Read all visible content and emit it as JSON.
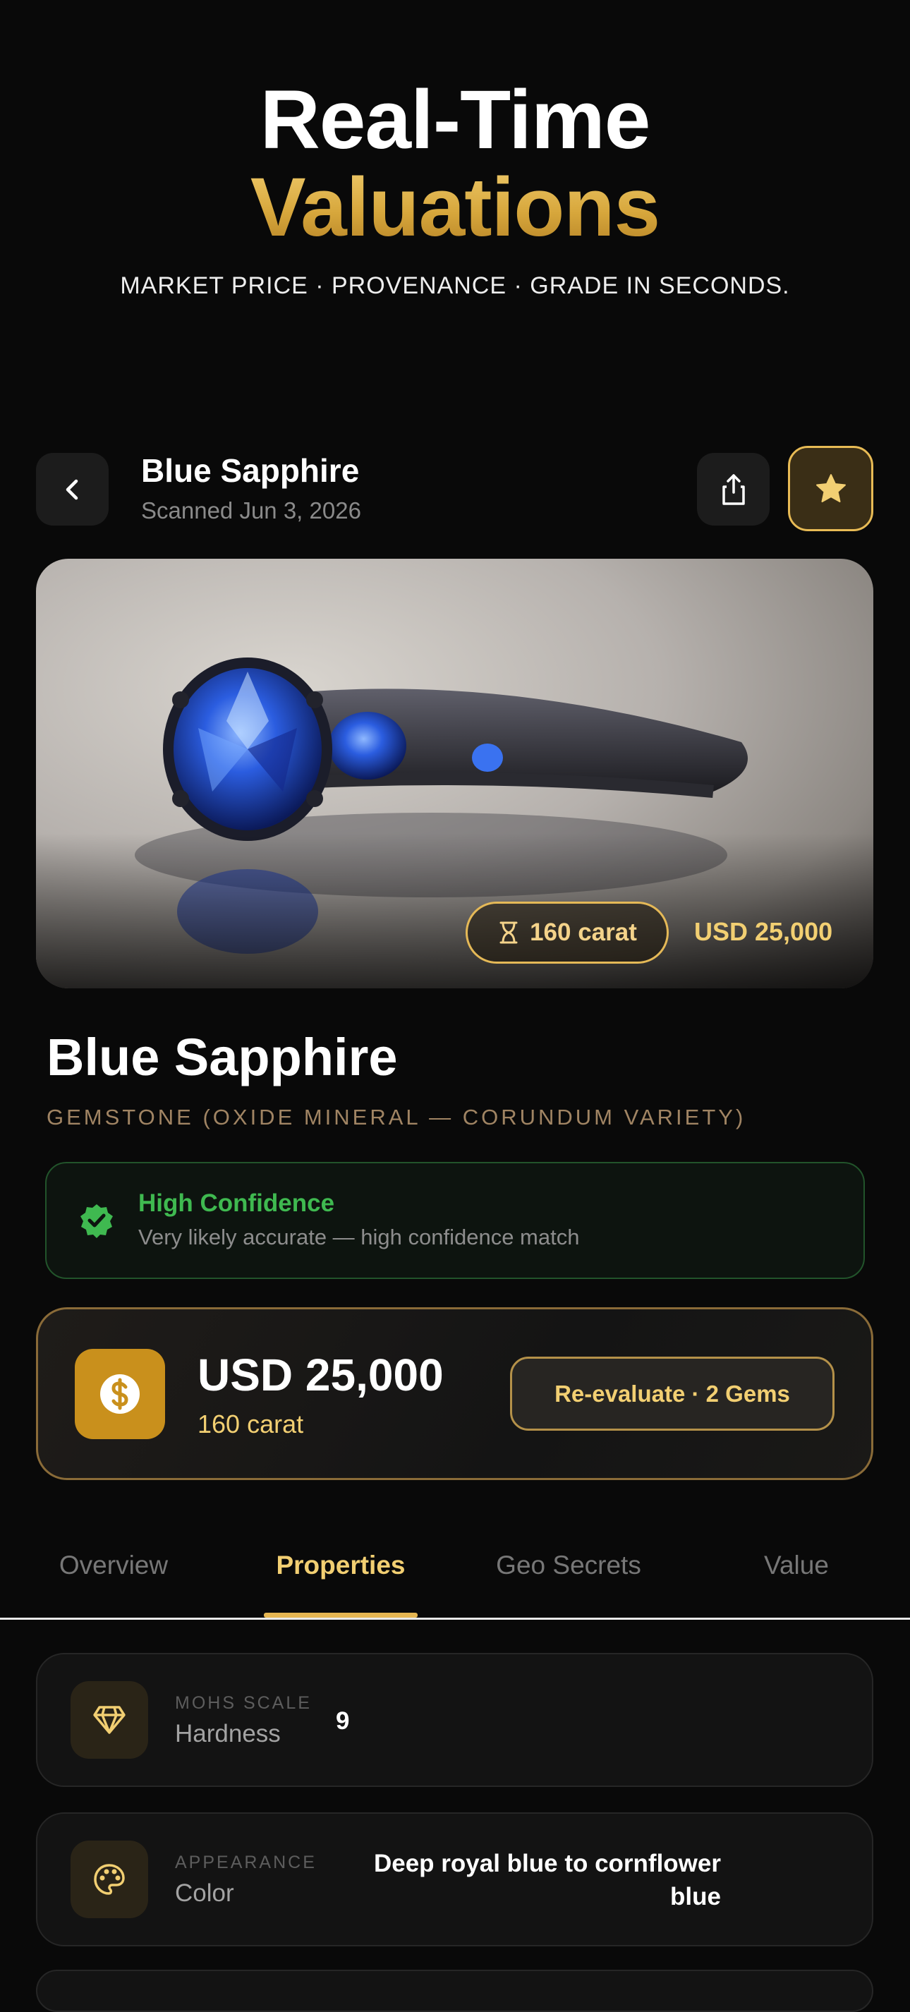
{
  "hero": {
    "line1": "Real-Time",
    "line2": "Valuations",
    "subtitle": "MARKET PRICE · PROVENANCE · GRADE IN SECONDS."
  },
  "header": {
    "title": "Blue Sapphire",
    "scanned": "Scanned Jun 3, 2026"
  },
  "image": {
    "carat_badge": "160 carat",
    "price": "USD 25,000"
  },
  "gem": {
    "name": "Blue Sapphire",
    "category": "GEMSTONE (OXIDE MINERAL — CORUNDUM VARIETY)"
  },
  "confidence": {
    "title": "High Confidence",
    "description": "Very likely accurate — high confidence match"
  },
  "valuation": {
    "amount": "USD 25,000",
    "carat": "160 carat",
    "reevaluate_label": "Re-evaluate · 2 Gems"
  },
  "tabs": [
    {
      "label": "Overview"
    },
    {
      "label": "Properties"
    },
    {
      "label": "Geo Secrets"
    },
    {
      "label": "Value"
    }
  ],
  "active_tab": "Properties",
  "properties": [
    {
      "kicker": "MOHS SCALE",
      "label": "Hardness",
      "value": "9",
      "icon": "diamond-icon"
    },
    {
      "kicker": "APPEARANCE",
      "label": "Color",
      "value_line1": "Deep royal blue to cornflower",
      "value_line2": "blue",
      "icon": "palette-icon"
    }
  ],
  "colors": {
    "gold": "#f2cf72",
    "confidence_green": "#3fb950",
    "background": "#090909"
  }
}
